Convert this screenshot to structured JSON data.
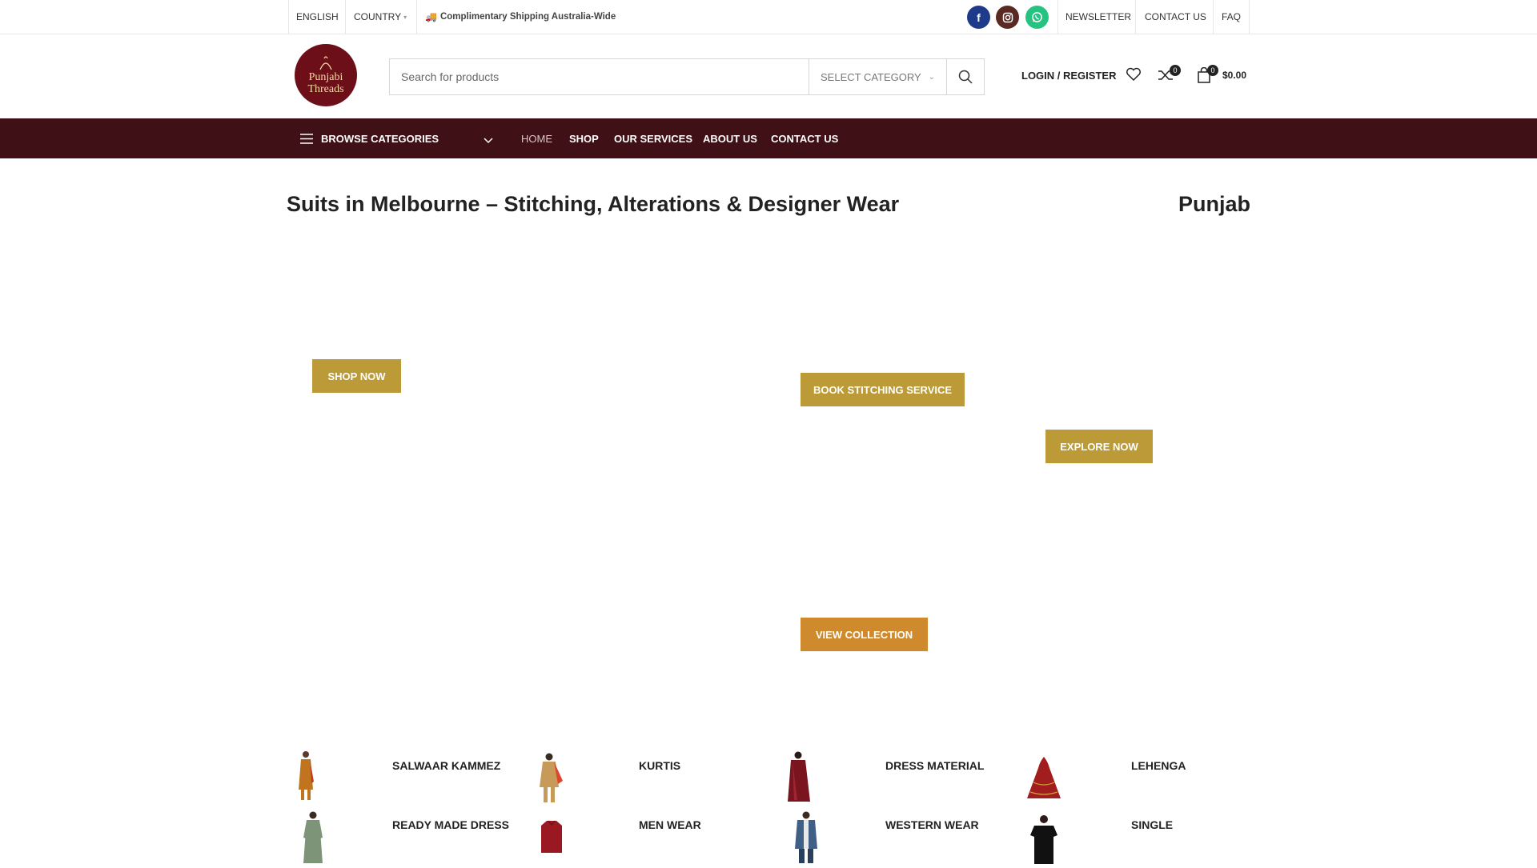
{
  "topbar": {
    "language": "ENGLISH",
    "country": "COUNTRY",
    "shipping": "Complimentary Shipping Australia-Wide",
    "social": [
      {
        "name": "facebook",
        "glyph": "f",
        "color": "#1e3a8a"
      },
      {
        "name": "instagram",
        "glyph": "◎",
        "color": "#5a2a22"
      },
      {
        "name": "whatsapp",
        "glyph": "✆",
        "color": "#25c281"
      }
    ],
    "links": [
      "NEWSLETTER",
      "CONTACT US",
      "FAQ"
    ]
  },
  "header": {
    "logo_text_1": "Punjabi",
    "logo_text_2": "Threads",
    "search_placeholder": "Search for products",
    "select_category": "SELECT CATEGORY",
    "login": "LOGIN / REGISTER",
    "compare_count": "0",
    "cart_count": "0",
    "cart_total": "$0.00"
  },
  "nav": {
    "browse": "BROWSE CATEGORIES",
    "links": [
      "HOME",
      "SHOP",
      "OUR SERVICES",
      "ABOUT US",
      "CONTACT US"
    ]
  },
  "hero": {
    "headline": "Suits in Melbourne – Stitching, Alterations & Designer Wear",
    "headline_next": "Punjab",
    "buttons": {
      "shop_now": "SHOP NOW",
      "book_stitching": "BOOK STITCHING SERVICE",
      "explore_now": "EXPLORE NOW",
      "view_collection": "VIEW COLLECTION"
    }
  },
  "categories": [
    {
      "label": "SALWAAR KAMMEZ",
      "color": "#c1741e"
    },
    {
      "label": "KURTIS",
      "color": "#c79a5a"
    },
    {
      "label": "DRESS MATERIAL",
      "color": "#7a1520"
    },
    {
      "label": "LEHENGA",
      "color": "#a21d1d"
    },
    {
      "label": "READY MADE DRESS",
      "color": "#7d9478"
    },
    {
      "label": "MEN WEAR",
      "color": "#9a1822"
    },
    {
      "label": "WESTERN WEAR",
      "color": "#3f5f86"
    },
    {
      "label": "SINGLE",
      "color": "#111111"
    }
  ]
}
